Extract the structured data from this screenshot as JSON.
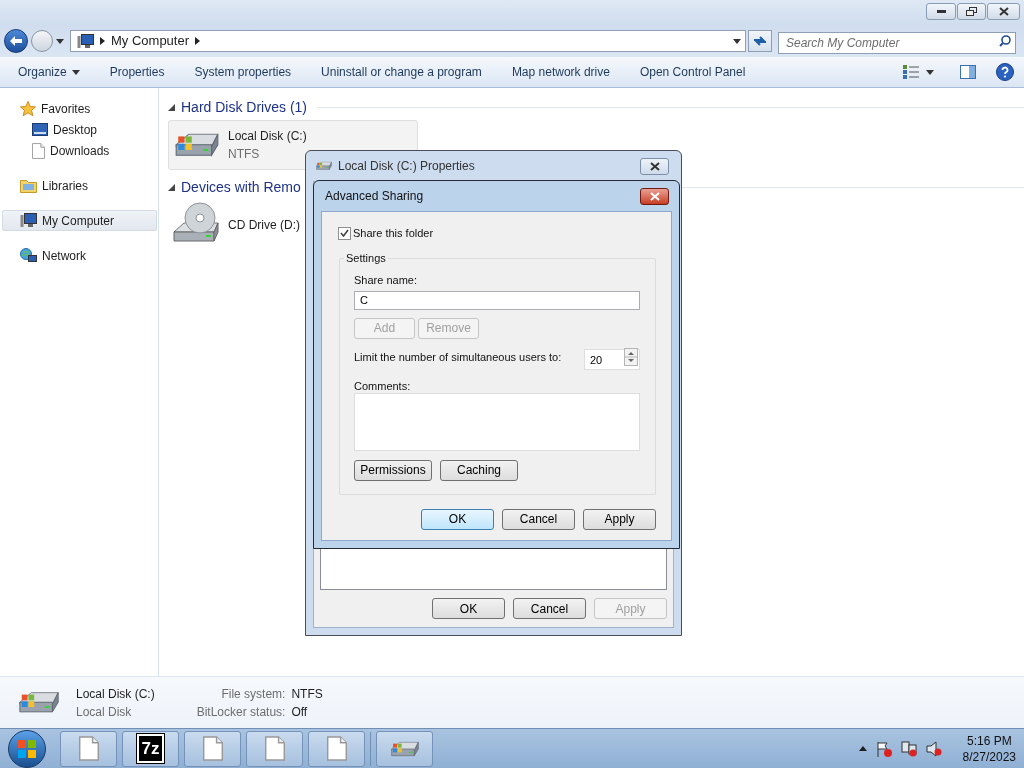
{
  "address_bar": {
    "path": "My Computer",
    "search_placeholder": "Search My Computer"
  },
  "command_bar": [
    {
      "label": "Organize",
      "dropdown": true
    },
    {
      "label": "Properties",
      "dropdown": false
    },
    {
      "label": "System properties",
      "dropdown": false
    },
    {
      "label": "Uninstall or change a program",
      "dropdown": false
    },
    {
      "label": "Map network drive",
      "dropdown": false
    },
    {
      "label": "Open Control Panel",
      "dropdown": false
    }
  ],
  "sidebar": [
    {
      "label": "Favorites",
      "kind": "star",
      "selected": false,
      "children": [
        {
          "label": "Desktop",
          "kind": "desktop",
          "selected": false
        },
        {
          "label": "Downloads",
          "kind": "document",
          "selected": false
        }
      ]
    },
    {
      "label": "Libraries",
      "kind": "library",
      "selected": false
    },
    {
      "label": "My Computer",
      "kind": "computer",
      "selected": true
    },
    {
      "label": "Network",
      "kind": "network",
      "selected": false
    }
  ],
  "groups": [
    {
      "title": "Hard Disk Drives (1)",
      "expanded": true,
      "items": [
        {
          "name": "Local Disk (C:)",
          "detail": "NTFS",
          "kind": "hdd",
          "selected": true
        }
      ]
    },
    {
      "title": "Devices with Remo",
      "expanded": true,
      "items": [
        {
          "name": "CD Drive (D:)",
          "kind": "cd",
          "selected": false
        }
      ]
    }
  ],
  "details_pane": {
    "name": "Local Disk (C:)",
    "type": "Local Disk",
    "fields": [
      {
        "label": "File system:",
        "value": "NTFS"
      },
      {
        "label": "BitLocker status:",
        "value": "Off"
      }
    ]
  },
  "properties_dialog": {
    "title": "Local Disk (C:) Properties",
    "buttons": [
      {
        "label": "OK",
        "disabled": false
      },
      {
        "label": "Cancel",
        "disabled": false
      },
      {
        "label": "Apply",
        "disabled": true
      }
    ]
  },
  "sharing_dialog": {
    "title": "Advanced Sharing",
    "share_checkbox": {
      "label": "Share this folder",
      "checked": true
    },
    "settings_label": "Settings",
    "share_name_label": "Share name:",
    "share_name": "C",
    "name_buttons": [
      {
        "label": "Add",
        "disabled": true
      },
      {
        "label": "Remove",
        "disabled": true
      }
    ],
    "limit_label": "Limit the number of simultaneous users to:",
    "limit_value": "20",
    "comments_label": "Comments:",
    "option_buttons": [
      {
        "label": "Permissions",
        "disabled": false
      },
      {
        "label": "Caching",
        "disabled": false
      }
    ],
    "buttons": [
      {
        "label": "OK",
        "disabled": false,
        "default": true
      },
      {
        "label": "Cancel",
        "disabled": false,
        "default": false
      },
      {
        "label": "Apply",
        "disabled": false,
        "default": false
      }
    ]
  },
  "taskbar": {
    "items": [
      {
        "kind": "document"
      },
      {
        "kind": "archive",
        "label": "7z"
      },
      {
        "kind": "document"
      },
      {
        "kind": "document"
      },
      {
        "kind": "document"
      },
      {
        "kind": "drive"
      }
    ],
    "time": "5:16 PM",
    "date": "8/27/2023"
  }
}
